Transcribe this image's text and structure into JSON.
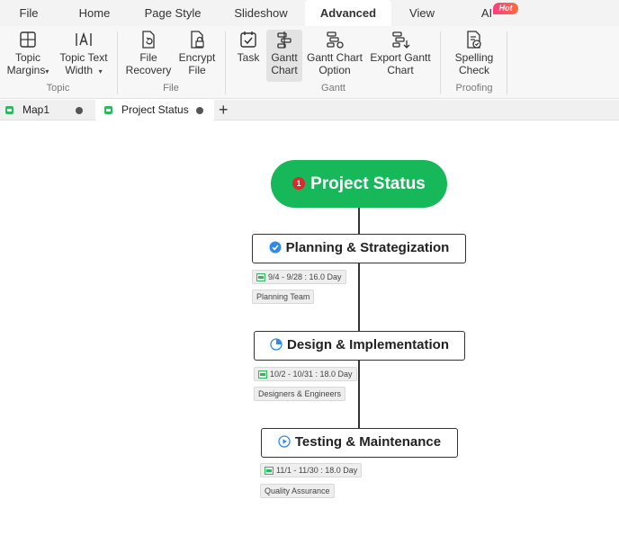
{
  "menu": {
    "tabs": [
      "File",
      "Home",
      "Page Style",
      "Slideshow",
      "Advanced",
      "View",
      "AI"
    ],
    "active": "Advanced",
    "ai_badge": "Hot"
  },
  "ribbon": {
    "topic_group": {
      "label": "Topic",
      "topic_margins": [
        "Topic",
        "Margins"
      ],
      "topic_text_width": [
        "Topic Text",
        "Width"
      ]
    },
    "file_group": {
      "label": "File",
      "file_recovery": [
        "File",
        "Recovery"
      ],
      "encrypt_file": [
        "Encrypt",
        "File"
      ]
    },
    "gantt_group": {
      "label": "Gantt",
      "task": "Task",
      "gantt_chart": [
        "Gantt",
        "Chart"
      ],
      "gantt_chart_option": [
        "Gantt Chart",
        "Option"
      ],
      "export_gantt_chart": [
        "Export Gantt",
        "Chart"
      ]
    },
    "proofing_group": {
      "label": "Proofing",
      "spelling_check": [
        "Spelling",
        "Check"
      ]
    }
  },
  "doc_tabs": [
    {
      "label": "Map1"
    },
    {
      "label": "Project Status"
    }
  ],
  "mindmap": {
    "root": {
      "label": "Project Status",
      "badge": "1",
      "color": "#16b85a"
    },
    "topics": [
      {
        "label": "Planning & Strategization",
        "icon": "check-circle-icon",
        "dates": "9/4 - 9/28 : 16.0 Day",
        "resource": "Planning Team"
      },
      {
        "label": "Design & Implementation",
        "icon": "pie-progress-icon",
        "dates": "10/2 - 10/31 : 18.0 Day",
        "resource": "Designers & Engineers"
      },
      {
        "label": "Testing & Maintenance",
        "icon": "play-circle-icon",
        "dates": "11/1 - 11/30 : 18.0 Day",
        "resource": "Quality Assurance"
      }
    ]
  }
}
